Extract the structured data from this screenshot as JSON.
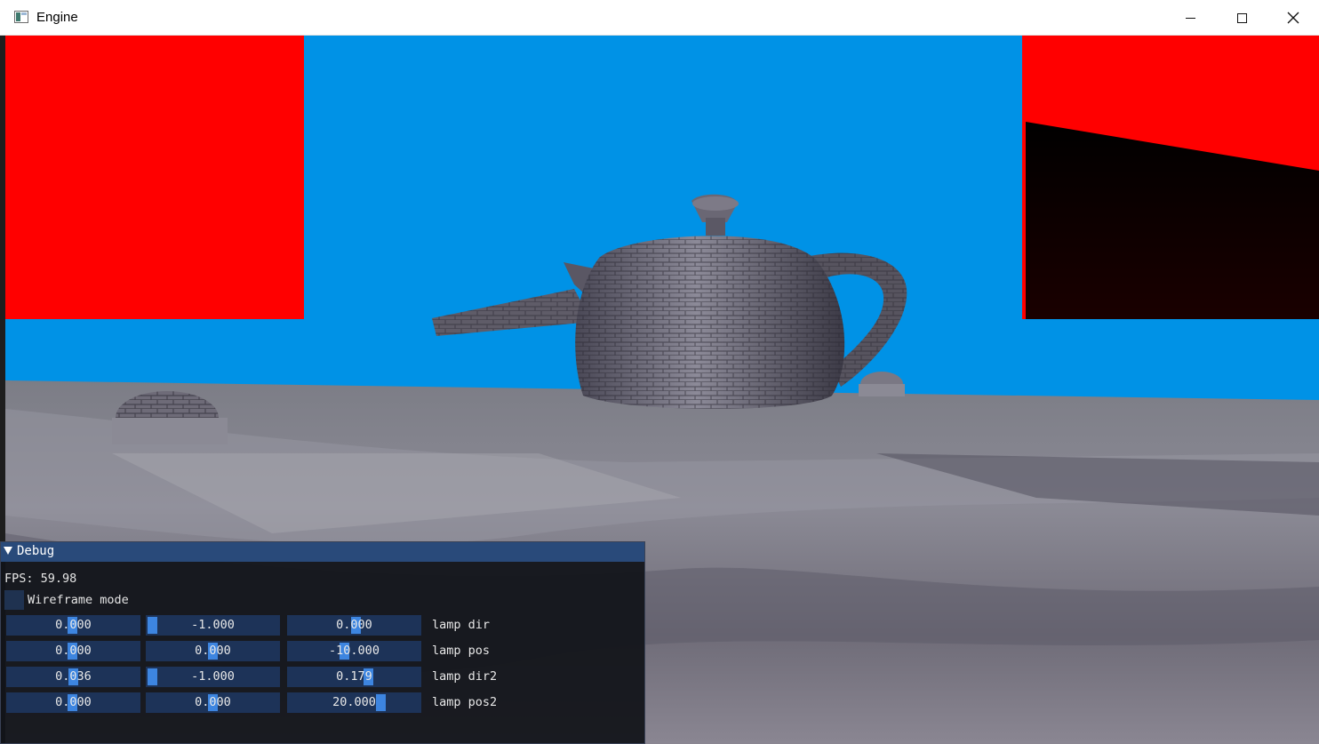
{
  "window": {
    "title": "Engine",
    "minimize_label": "—",
    "maximize_label": "☐",
    "close_label": "✕"
  },
  "scene": {
    "sky_color": "#0092e6",
    "panel_color": "#ff0000",
    "object": "teapot"
  },
  "debug_panel": {
    "title": "Debug",
    "fps_text": "FPS: 59.98",
    "wireframe_label": "Wireframe mode",
    "wireframe_checked": false,
    "rows": [
      {
        "label": "lamp dir",
        "values": [
          "0.000",
          "-1.000",
          "0.000"
        ]
      },
      {
        "label": "lamp pos",
        "values": [
          "0.000",
          "0.000",
          "-10.000"
        ]
      },
      {
        "label": "lamp dir2",
        "values": [
          "0.036",
          "-1.000",
          "0.179"
        ]
      },
      {
        "label": "lamp pos2",
        "values": [
          "0.000",
          "0.000",
          "20.000"
        ]
      }
    ],
    "accent_color": "#3d85e0",
    "field_color": "#1d3358"
  }
}
